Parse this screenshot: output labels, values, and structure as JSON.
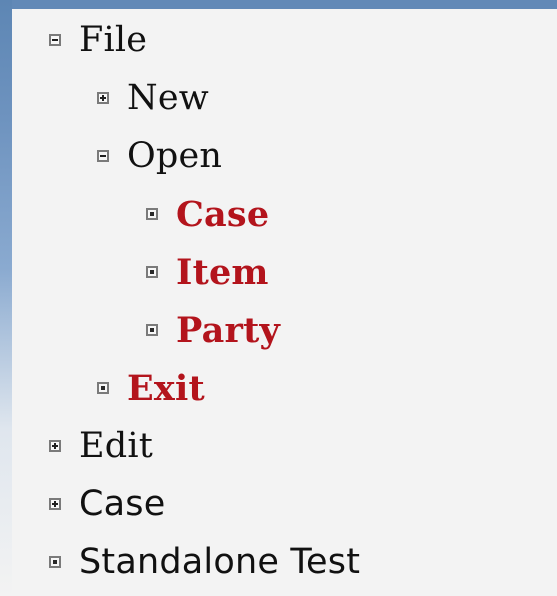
{
  "colors": {
    "background": "#f3f3f3",
    "accent_blue": "#6289b7",
    "active_red": "#b3141c",
    "text": "#111111",
    "icon_border": "#7a7a7a"
  },
  "tree": {
    "items": [
      {
        "label": "File",
        "toggle": "minus-icon",
        "style": "normal"
      },
      {
        "label": "New",
        "toggle": "plus-icon",
        "style": "normal"
      },
      {
        "label": "Open",
        "toggle": "minus-icon",
        "style": "normal"
      },
      {
        "label": "Case",
        "toggle": "leaf-icon",
        "style": "selected"
      },
      {
        "label": "Item",
        "toggle": "leaf-icon",
        "style": "selected"
      },
      {
        "label": "Party",
        "toggle": "leaf-icon",
        "style": "selected"
      },
      {
        "label": "Exit",
        "toggle": "leaf-icon",
        "style": "selected"
      },
      {
        "label": "Edit",
        "toggle": "plus-icon",
        "style": "normal"
      },
      {
        "label": "Case",
        "toggle": "plus-icon",
        "style": "normal"
      },
      {
        "label": "Standalone Test",
        "toggle": "leaf-icon",
        "style": "normal"
      }
    ]
  }
}
